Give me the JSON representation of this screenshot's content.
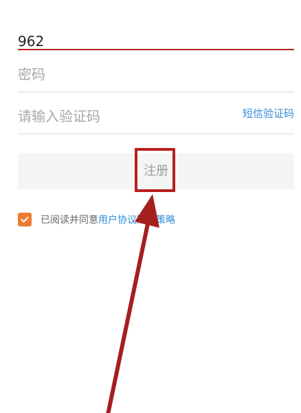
{
  "form": {
    "phone_value": "962",
    "password_placeholder": "密码",
    "code_placeholder": "请输入验证码",
    "sms_link": "短信验证码",
    "register_label": "注册"
  },
  "agreement": {
    "checked": true,
    "text": "已阅读并同意",
    "link_text": "用户协议隐私策略"
  },
  "colors": {
    "active_underline": "#b62626",
    "link": "#2f8bd8",
    "checkbox": "#ee7b34",
    "annotation": "#b91e1e"
  },
  "icons": {
    "checkbox_mark": "check-icon",
    "annotation_pointer": "red-arrow"
  }
}
